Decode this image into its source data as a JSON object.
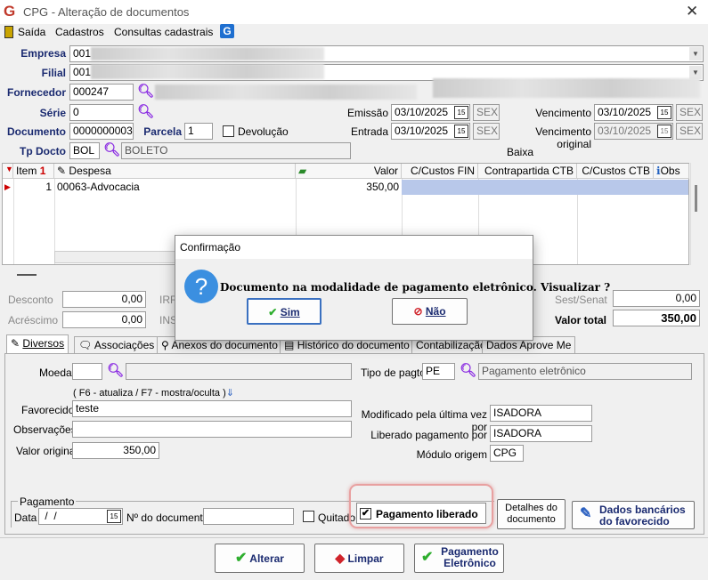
{
  "window": {
    "title": "CPG - Alteração de documentos",
    "close": "✕",
    "logo": "G"
  },
  "menu": {
    "saida": "Saída",
    "cadastros": "Cadastros",
    "consultas": "Consultas cadastrais"
  },
  "labels": {
    "empresa": "Empresa",
    "filial": "Filial",
    "fornecedor": "Fornecedor",
    "serie": "Série",
    "documento": "Documento",
    "parcela": "Parcela",
    "devolucao": "Devolução",
    "tp_docto": "Tp Docto",
    "emissao": "Emissão",
    "entrada": "Entrada",
    "vencimento": "Vencimento",
    "vencimento_original": "Vencimento original",
    "baixa": "Baixa"
  },
  "fields": {
    "empresa": "001",
    "filial": "001",
    "fornecedor": "000247",
    "serie": "0",
    "documento": "0000000003",
    "parcela": "1",
    "tp_docto": "BOL",
    "tp_docto_desc": "BOLETO",
    "emissao": "03/10/2025",
    "emissao_dia": "SEX",
    "entrada": "03/10/2025",
    "entrada_dia": "SEX",
    "vencimento": "03/10/2025",
    "vencimento_dia": "SEX",
    "vencimento_original": "03/10/2025",
    "vencimento_original_dia": "SEX"
  },
  "grid": {
    "headers": {
      "item": "Item",
      "despesa": "Despesa",
      "valor": "Valor",
      "cc_fin": "C/Custos FIN",
      "contrapartida": "Contrapartida CTB",
      "cc_ctb": "C/Custos CTB",
      "obs": "Obs"
    },
    "rows": [
      {
        "item": "1",
        "despesa": "00063-Advocacia",
        "valor": "350,00"
      }
    ]
  },
  "totals": {
    "desconto_label": "Desconto",
    "desconto": "0,00",
    "acrescimo_label": "Acréscimo",
    "acrescimo": "0,00",
    "irrf_label": "IRR",
    "ins_label": "INS",
    "sest_label": "Sest/Senat",
    "sest": "0,00",
    "valor_total_label": "Valor total",
    "valor_total": "350,00"
  },
  "tabs": [
    "Diversos",
    "Associações",
    "Anexos do documento",
    "Histórico do documento",
    "Contabilização",
    "Dados Aprove Me"
  ],
  "diversos": {
    "moeda_label": "Moeda",
    "moeda": "",
    "hint": "( F6 - atualiza / F7 - mostra/oculta )",
    "favorecido_label": "Favorecido",
    "favorecido": "teste",
    "observacoes_label": "Observações",
    "observacoes": "",
    "valor_original_label": "Valor original",
    "valor_original": "350,00",
    "tipo_pagto_label": "Tipo de pagto",
    "tipo_pagto": "PE",
    "tipo_pagto_desc": "Pagamento eletrônico",
    "modificado_label": "Modificado pela última vez por",
    "modificado": "ISADORA",
    "liberado_label": "Liberado pagamento por",
    "liberado": "ISADORA",
    "modulo_label": "Módulo origem",
    "modulo": "CPG"
  },
  "pagamento": {
    "group_label": "Pagamento",
    "data_label": "Data",
    "data": " /  /",
    "ndoc_label": "Nº do documento",
    "ndoc": "",
    "quitado_label": "Quitado",
    "liberado_label": "Pagamento liberado",
    "liberado_checked": true,
    "detalhes_label": "Detalhes do documento",
    "dados_bancarios_label": "Dados bancários do favorecido"
  },
  "buttons": {
    "alterar": "Alterar",
    "limpar": "Limpar",
    "pagamento_eletronico": "Pagamento Eletrônico"
  },
  "dialog": {
    "title": "Confirmação",
    "message": "Documento na modalidade de pagamento eletrônico. Visualizar ?",
    "sim": "Sim",
    "nao": "Não"
  }
}
